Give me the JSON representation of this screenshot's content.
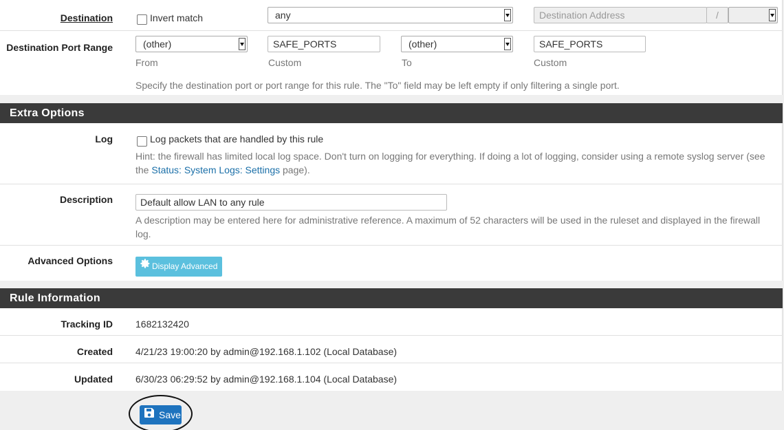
{
  "destination": {
    "label": "Destination",
    "invert_label": "Invert match",
    "type_value": "any",
    "address_placeholder": "Destination Address",
    "slash": "/"
  },
  "port_range": {
    "label": "Destination Port Range",
    "from_select": "(other)",
    "from_custom": "SAFE_PORTS",
    "to_select": "(other)",
    "to_custom": "SAFE_PORTS",
    "from_label": "From",
    "custom_label_1": "Custom",
    "to_label": "To",
    "custom_label_2": "Custom",
    "hint": "Specify the destination port or port range for this rule. The \"To\" field may be left empty if only filtering a single port."
  },
  "extra_options": {
    "heading": "Extra Options",
    "log_label": "Log",
    "log_checkbox_label": "Log packets that are handled by this rule",
    "log_hint_1": "Hint: the firewall has limited local log space. Don't turn on logging for everything. If doing a lot of logging, consider using a remote syslog server (see",
    "log_hint_the": "the ",
    "log_hint_link": "Status: System Logs: Settings",
    "log_hint_end": " page).",
    "description_label": "Description",
    "description_value": "Default allow LAN to any rule",
    "description_hint_1": "A description may be entered here for administrative reference. A maximum of 52 characters will be used in the ruleset and displayed in the firewall",
    "description_hint_2": "log.",
    "advanced_label": "Advanced Options",
    "advanced_button": "Display Advanced"
  },
  "rule_information": {
    "heading": "Rule Information",
    "tracking_label": "Tracking ID",
    "tracking_value": "1682132420",
    "created_label": "Created",
    "created_value": "4/21/23 19:00:20 by admin@192.168.1.102 (Local Database)",
    "updated_label": "Updated",
    "updated_value": "6/30/23 06:29:52 by admin@192.168.1.104 (Local Database)"
  },
  "save_button": "Save",
  "colors": {
    "heading_bg": "#3a3a3a",
    "info_button": "#5bc0de",
    "save_button": "#1e73be",
    "link": "#1a6fa8"
  }
}
